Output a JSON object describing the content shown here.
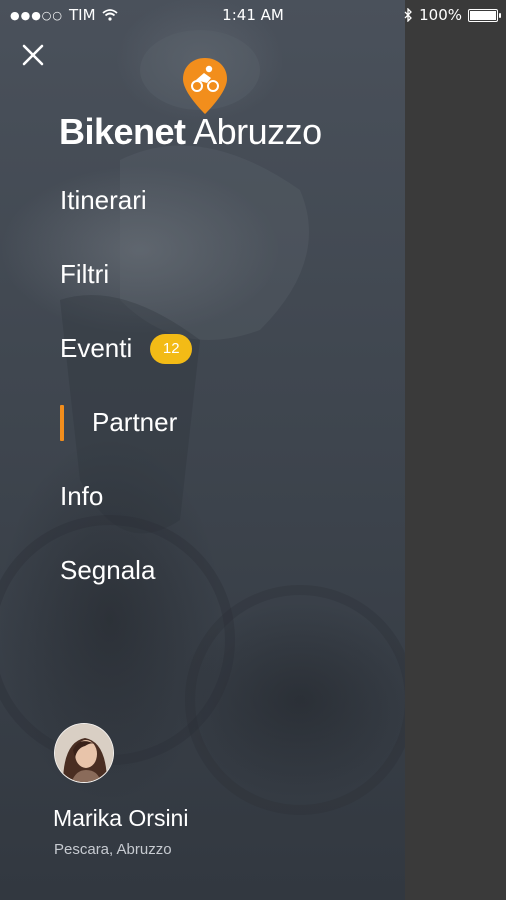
{
  "status_bar": {
    "carrier": "TIM",
    "time": "1:41 AM",
    "battery": "100%",
    "signal_icon": "signal-dots-icon",
    "wifi_icon": "wifi-icon",
    "bluetooth_icon": "bluetooth-icon",
    "battery_level": 1.0
  },
  "brand": {
    "name_bold": "Bikenet",
    "name_light": "Abruzzo",
    "logo_icon": "cyclist-pin-icon",
    "accent_color": "#f28e1c"
  },
  "menu": {
    "items": [
      {
        "label": "Itinerari"
      },
      {
        "label": "Filtri"
      },
      {
        "label": "Eventi",
        "badge": "12"
      },
      {
        "label": "Partner",
        "active": true
      },
      {
        "label": "Info"
      },
      {
        "label": "Segnala"
      }
    ],
    "badge_color": "#f3bb16"
  },
  "close_icon": "close-icon",
  "user": {
    "name": "Marika Orsini",
    "location": "Pescara, Abruzzo"
  }
}
